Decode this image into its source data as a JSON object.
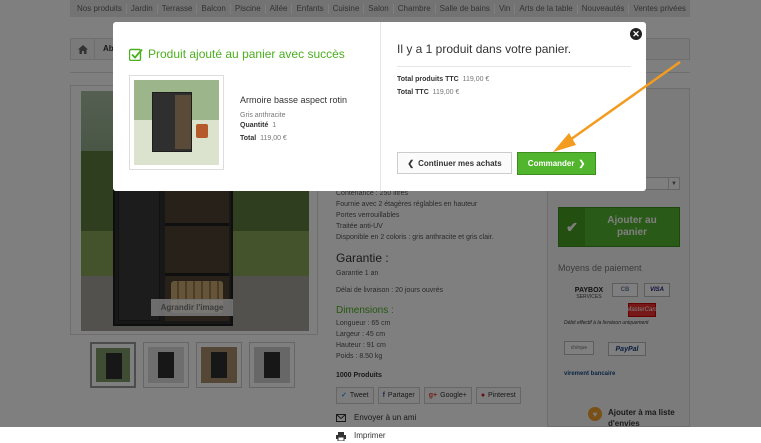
{
  "nav": {
    "categories": [
      "Nos produits",
      "Jardin",
      "Terrasse",
      "Balcon",
      "Piscine",
      "Allée",
      "Enfants",
      "Cuisine",
      "Salon",
      "Chambre",
      "Salle de bains",
      "Vin",
      "Arts de la table",
      "Nouveautés",
      "Ventes privées"
    ]
  },
  "breadcrumb": {
    "text": "Abr"
  },
  "product": {
    "zoom_label": "Agrandir l'image",
    "details": [
      "Contenance : 250 litres",
      "Fournie avec 2 étagères réglables en hauteur",
      "Portes verrouillables",
      "Traitée anti-UV",
      "Disponible en 2 coloris : gris anthracite et gris clair."
    ],
    "guarantee_title": "Garantie :",
    "guarantee_lines": [
      "Garantie 1 an",
      "Délai de livraison : 20 jours ouvrés"
    ],
    "dimensions_title": "Dimensions :",
    "dimensions": [
      "Longueur : 65 cm",
      "Largeur : 45 cm",
      "Hauteur : 91 cm",
      "Poids : 8.50 kg"
    ],
    "count": "1000 Produits",
    "share": {
      "tweet": "Tweet",
      "share": "Partager",
      "gplus": "Google+",
      "pinterest": "Pinterest"
    },
    "send_friend": "Envoyer à un ami",
    "print": "Imprimer"
  },
  "sidebar": {
    "add_to_cart": "Ajouter au\npanier",
    "payment_title": "Moyens de paiement",
    "paybox_name": "PAYBOX",
    "paybox_sub": "SERVICES",
    "cb_label": "CB",
    "visa_label": "VISA",
    "mc_label": "MasterCard",
    "pay_note": "Débit effectif à la livraison uniquement",
    "cheque_label": "chèque",
    "paypal_label": "PayPal",
    "virement_label": "virement bancaire",
    "wishlist": "Ajouter à ma liste d'envies"
  },
  "modal": {
    "success_title": "Produit ajouté au panier avec succès",
    "product_name": "Armoire basse aspect rotin",
    "attributes": "Gris anthracite",
    "quantity_label": "Quantité",
    "quantity_value": "1",
    "total_label": "Total",
    "total_value": "119,00 €",
    "cart_title": "Il y a 1 produit dans votre panier.",
    "total_products_label": "Total produits TTC",
    "total_products_value": "119,00 €",
    "total_ttc_label": "Total TTC",
    "total_ttc_value": "119,00 €",
    "continue_label": "Continuer mes achats",
    "order_label": "Commander"
  },
  "colors": {
    "accent_green": "#52b52e",
    "annotation_arrow": "#f39c1f"
  }
}
